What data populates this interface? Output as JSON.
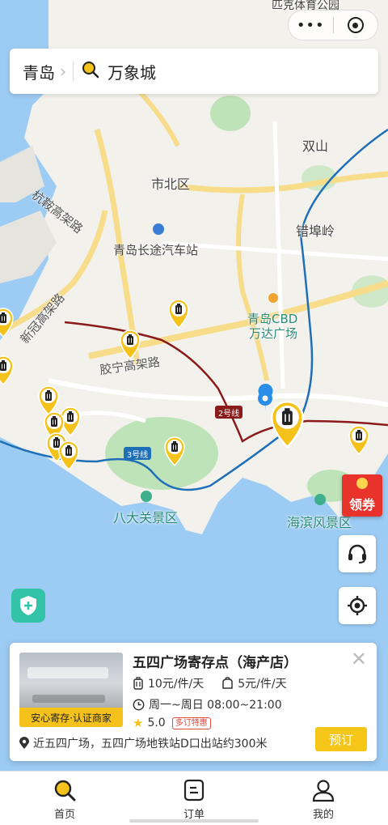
{
  "top_capsule": {
    "more_icon": "more-dots-icon",
    "close_icon": "target-circle-icon"
  },
  "search": {
    "city": "青岛",
    "city_chevron": "›",
    "query": "万象城"
  },
  "map": {
    "labels": {
      "top_park": "匹克体育公园",
      "shuangshan": "双山",
      "shibei": "市北区",
      "cuobuling": "错埠岭",
      "hangqiao_road": "杭鞍高架路",
      "bus_station": "青岛长途汽车站",
      "xinguan_road": "新冠高架路",
      "wanda": "青岛CBD",
      "wanda2": "万达广场",
      "jiaoning_road": "胶宁高架路",
      "line2": "2号线",
      "line3": "3号线",
      "badaguan": "八大关景区",
      "haibin": "海滨风景区"
    },
    "colors": {
      "line2": "#8b1a1a",
      "line3": "#1e6fb8",
      "marker": "#f4c21b"
    }
  },
  "coupon": {
    "label": "领券"
  },
  "card": {
    "name": "五四广场寄存点（海产店）",
    "badge": "安心寄存·认证商家",
    "price_large": "10元/件/天",
    "price_small": "5元/件/天",
    "hours": "周一~周日 08:00~21:00",
    "rating": "5.0",
    "discount_tag": "多订特惠",
    "address": "近五四广场，五四广场地铁站D口出站约300米",
    "book_label": "预订"
  },
  "tabbar": {
    "items": [
      {
        "label": "首页",
        "icon": "search-icon"
      },
      {
        "label": "订单",
        "icon": "order-icon"
      },
      {
        "label": "我的",
        "icon": "user-icon"
      }
    ]
  }
}
